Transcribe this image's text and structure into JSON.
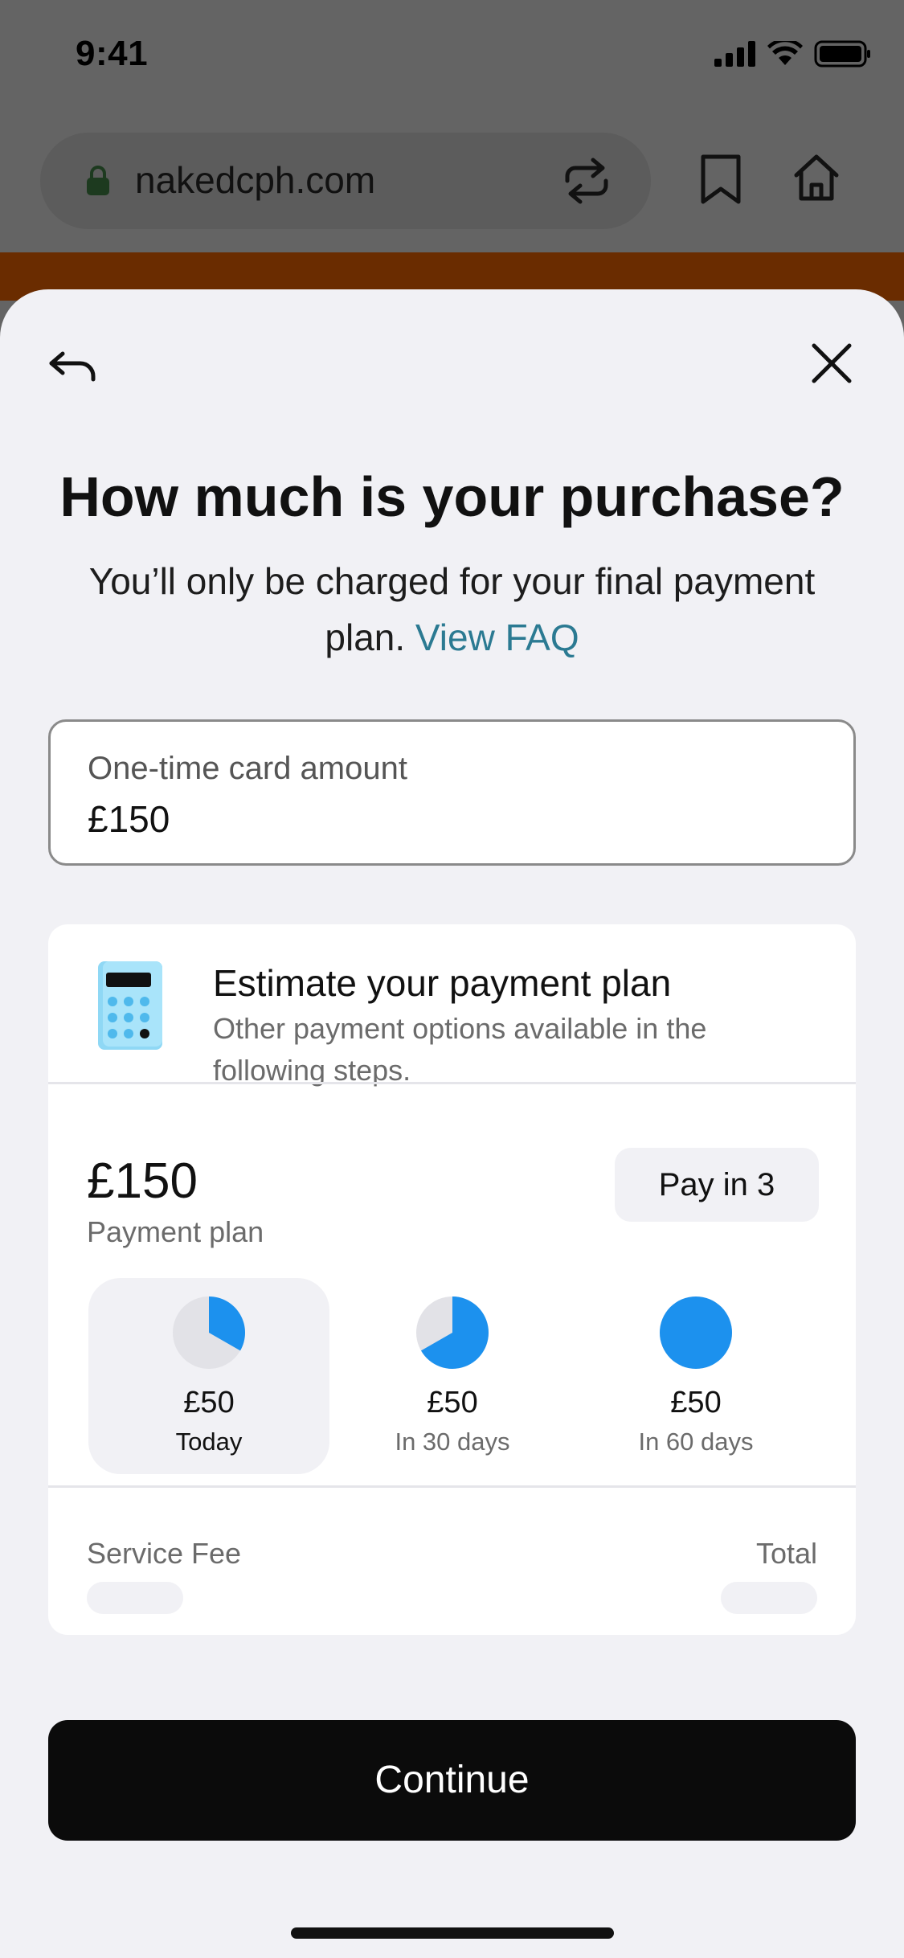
{
  "status_bar": {
    "time": "9:41"
  },
  "browser": {
    "url": "nakedcph.com"
  },
  "sheet": {
    "title": "How much is your purchase?",
    "subtitle": "You’ll only be charged for your final payment plan.",
    "faq_link": "View FAQ",
    "amount_field": {
      "label": "One-time card amount",
      "value": "£150"
    },
    "estimate_card": {
      "title": "Estimate your payment plan",
      "description": "Other payment options available in the following steps.",
      "plan_amount": "£150",
      "plan_label": "Payment plan",
      "pay_option": "Pay in 3",
      "installments": [
        {
          "amount": "£50",
          "when": "Today",
          "progress": 0.333,
          "selected": true
        },
        {
          "amount": "£50",
          "when": "In 30 days",
          "progress": 0.667,
          "selected": false
        },
        {
          "amount": "£50",
          "when": "In 60 days",
          "progress": 1.0,
          "selected": false
        }
      ],
      "service_fee_label": "Service Fee",
      "total_label": "Total"
    },
    "continue_label": "Continue"
  },
  "colors": {
    "accent_blue": "#1c91ee",
    "pie_track": "#e2e2e7",
    "link": "#2b7a92",
    "button": "#0b0b0b"
  }
}
